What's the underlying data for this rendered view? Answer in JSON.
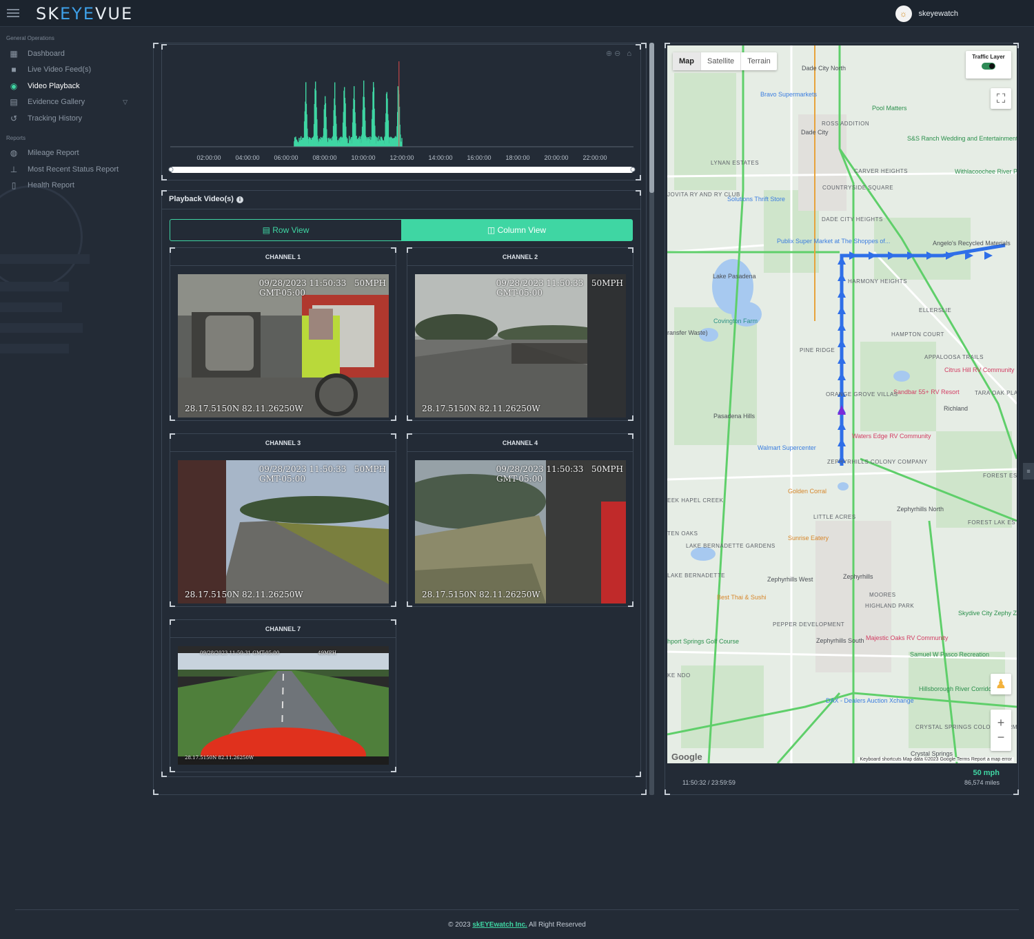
{
  "app": {
    "logo_prefix": "SK",
    "logo_accent": "EYE",
    "logo_suffix": "VUE",
    "user": {
      "name": "skeyewatch"
    }
  },
  "sidebar": {
    "section_general": "General Operations",
    "items": [
      {
        "label": "Dashboard",
        "icon": "dashboard-icon"
      },
      {
        "label": "Live Video Feed(s)",
        "icon": "video-camera-icon"
      },
      {
        "label": "Video Playback",
        "icon": "play-circle-icon",
        "active": true
      },
      {
        "label": "Evidence Gallery",
        "icon": "gallery-icon"
      },
      {
        "label": "Tracking History",
        "icon": "history-icon"
      }
    ],
    "section_reports": "Reports",
    "reports": [
      {
        "label": "Mileage Report",
        "icon": "gauge-icon"
      },
      {
        "label": "Most Recent Status Report",
        "icon": "antenna-icon"
      },
      {
        "label": "Health Report",
        "icon": "document-icon"
      }
    ]
  },
  "timeline": {
    "ticks": [
      "02:00:00",
      "04:00:00",
      "06:00:00",
      "08:00:00",
      "10:00:00",
      "12:00:00",
      "14:00:00",
      "16:00:00",
      "18:00:00",
      "20:00:00",
      "22:00:00"
    ],
    "bar_color": "#3fd6a3",
    "marker_color": "#e04b4b"
  },
  "playback": {
    "title": "Playback Video(s)",
    "row_view": "Row View",
    "column_view": "Column View",
    "channels": [
      {
        "title": "CHANNEL 1",
        "timestamp": "09/28/2023 11:50:33",
        "tz": "GMT-05:00",
        "speed": "50MPH",
        "coords": "28.17.5150N 82.11.26250W"
      },
      {
        "title": "CHANNEL 2",
        "timestamp": "09/28/2023 11:50:33",
        "tz": "GMT-05:00",
        "speed": "50MPH",
        "coords": "28.17.5150N 82.11.26250W"
      },
      {
        "title": "CHANNEL 3",
        "timestamp": "09/28/2023 11:50:33",
        "tz": "GMT-05:00",
        "speed": "50MPH",
        "coords": "28.17.5150N 82.11.26250W"
      },
      {
        "title": "CHANNEL 4",
        "timestamp": "09/28/2023 11:50:33",
        "tz": "GMT-05:00",
        "speed": "50MPH",
        "coords": "28.17.5150N 82.11.26250W"
      },
      {
        "title": "CHANNEL 7",
        "timestamp": "09/28/2023 11:50:31 GMT-05:00",
        "speed": "49MPH",
        "coords": "28.17.5150N 82.11.26250W"
      }
    ]
  },
  "map": {
    "types": [
      "Map",
      "Satellite",
      "Terrain"
    ],
    "selected_type": "Map",
    "traffic_layer": "Traffic Layer",
    "google": "Google",
    "attribution": "Keyboard shortcuts   Map data ©2023 Google   Terms   Report a map error",
    "route_color": "#2f6fe8",
    "labels": {
      "dade_city_north": "Dade City North",
      "bravo": "Bravo Supermarkets",
      "pool": "Pool Matters",
      "ross": "ROSS ADDITION",
      "dade_city": "Dade City",
      "sands": "S&S Ranch Wedding and Entertainment Venue",
      "lynan": "LYNAN ESTATES",
      "carver": "CARVER HEIGHTS",
      "withla": "Withlacoochee River Park",
      "countryside": "COUNTRYSIDE SQUARE",
      "jovita": "JOVITA RY AND RY CLUB",
      "solutions": "Solutions Thrift Store",
      "dade_heights": "DADE CITY HEIGHTS",
      "publix": "Publix Super Market at The Shoppes of...",
      "angelos": "Angelo's Recycled Materials",
      "harmony": "HARMONY HEIGHTS",
      "lake_pasadena": "Lake Pasadena",
      "ellerslie": "ELLERSLIE",
      "covington": "Covington Farm",
      "hampton": "HAMPTON COURT",
      "transfer": "ransfer Waste)",
      "pine_ridge": "PINE RIDGE",
      "appaloosa": "APPALOOSA TRAILS",
      "citrus": "Citrus Hill RV Community",
      "sandbar": "Sandbar 55+ RV Resort",
      "tara": "TARA OAK PLANTATI",
      "orange_grove": "ORANGE GROVE VILLAS",
      "richland": "Richland",
      "pasadena_hills": "Pasadena Hills",
      "waters_edge": "Waters Edge RV Community",
      "walmart": "Walmart Supercenter",
      "zeph_hills_colony": "ZEPHYRHILLS COLONY COMPANY",
      "forest_estates": "FOREST ESTATES HOME P",
      "golden": "Golden Corral",
      "creek": "EEK HAPEL CREEK",
      "little_acres": "LITTLE ACRES",
      "zeph_north": "Zephyrhills North",
      "forest_lake": "FOREST LAK ESTATES MOBILE HOM PARK CO-O",
      "ten_oaks": "TEN OAKS",
      "sunrise": "Sunrise Eatery",
      "lake_bern_gardens": "LAKE BERNADETTE GARDENS",
      "lake_bern": "LAKE BERNADETTE",
      "zeph_west": "Zephyrhills West",
      "zephyrhills": "Zephyrhills",
      "best_thai": "Best Thai & Sushi",
      "moores": "MOORES",
      "highland": "HIGHLAND PARK",
      "skydive": "Skydive City Zephy ZHills, Zephyrhills",
      "pepper": "PEPPER DEVELOPMENT",
      "springs_golf": "hport Springs Golf Course",
      "zeph_south": "Zephyrhills South",
      "majestic": "Majestic Oaks RV Community",
      "samuel": "Samuel W Pasco Recreation",
      "kendo": "KE NDO",
      "hillsborough": "Hillsborough River Corridor",
      "dax": "DAX - Dealers Auction Xchange",
      "crystal_colony": "CRYSTAL SPRINGS COLONY FARMS",
      "crystal": "Crystal Springs"
    }
  },
  "status": {
    "time": "11:50:32 / 23:59:59",
    "speed": "50 mph",
    "miles": "86,574 miles"
  },
  "footer": {
    "prefix": "© 2023",
    "link": "skEYEwatch Inc.",
    "suffix": "All Right Reserved"
  }
}
